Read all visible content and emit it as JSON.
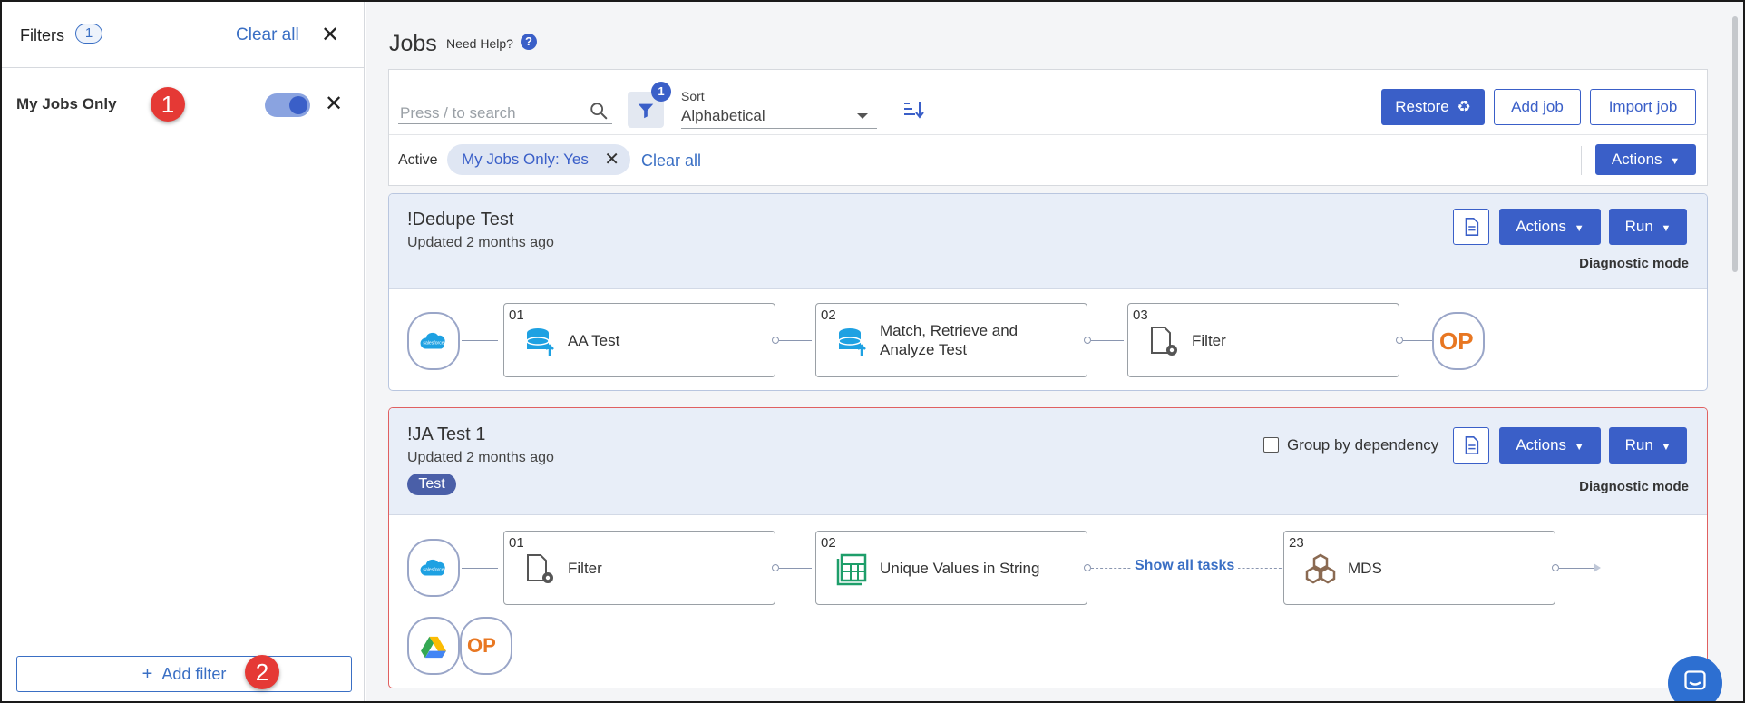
{
  "filters": {
    "title": "Filters",
    "count": "1",
    "clear_all": "Clear all",
    "my_jobs_only_label": "My Jobs Only",
    "my_jobs_only_enabled": true,
    "add_filter": "Add filter",
    "badge_1": "1",
    "badge_2": "2"
  },
  "header": {
    "title": "Jobs",
    "need_help": "Need Help?",
    "help_glyph": "?"
  },
  "toolbar": {
    "search_placeholder": "Press / to search",
    "filter_badge": "1",
    "sort_label": "Sort",
    "sort_value": "Alphabetical",
    "restore": "Restore",
    "add_job": "Add job",
    "import_job": "Import job",
    "active_label": "Active",
    "active_chip": "My Jobs Only: Yes",
    "clear_all": "Clear all",
    "actions": "Actions"
  },
  "jobs": [
    {
      "name": "!Dedupe Test",
      "updated": "Updated 2 months ago",
      "actions": "Actions",
      "run": "Run",
      "diagnostic": "Diagnostic mode",
      "source_logo": "salesforce",
      "target_logo": "OP",
      "tasks": [
        {
          "num": "01",
          "label": "AA Test",
          "icon": "database-upload-icon"
        },
        {
          "num": "02",
          "label": "Match, Retrieve and Analyze Test",
          "icon": "database-upload-icon"
        },
        {
          "num": "03",
          "label": "Filter",
          "icon": "file-gear-icon"
        }
      ]
    },
    {
      "name": "!JA Test 1",
      "updated": "Updated 2 months ago",
      "tag": "Test",
      "group_by_dependency": "Group by dependency",
      "actions": "Actions",
      "run": "Run",
      "diagnostic": "Diagnostic mode",
      "source_logo": "salesforce",
      "show_all_tasks": "Show all tasks",
      "extra_logos": [
        "google-drive",
        "OP"
      ],
      "tasks": [
        {
          "num": "01",
          "label": "Filter",
          "icon": "file-gear-icon"
        },
        {
          "num": "02",
          "label": "Unique Values in String",
          "icon": "spreadsheet-icon"
        },
        {
          "num": "23",
          "label": "MDS",
          "icon": "hexagons-icon"
        }
      ]
    }
  ],
  "colors": {
    "primary": "#3a5fc8",
    "link": "#3a6fc4",
    "badge_red": "#e53935",
    "error_border": "#e06060",
    "op_orange": "#e87722"
  }
}
